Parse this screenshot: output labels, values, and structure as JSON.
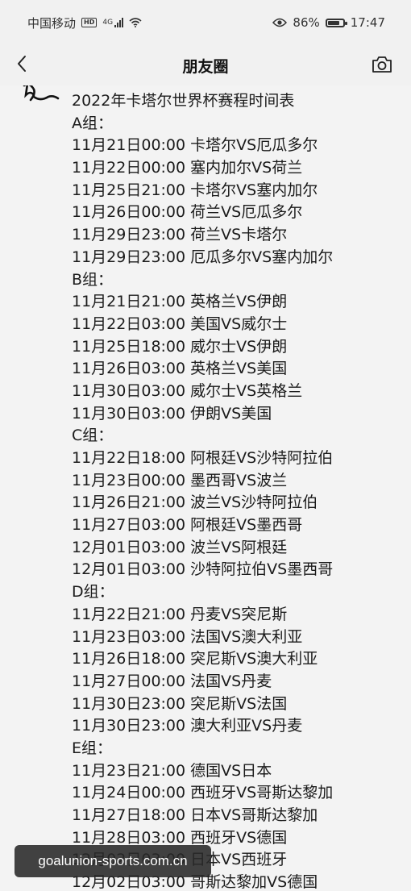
{
  "status_bar": {
    "carrier": "中国移动",
    "hd": "HD",
    "network": "4G",
    "battery": "86%",
    "time": "17:47"
  },
  "nav": {
    "title": "朋友圈"
  },
  "post": {
    "lines": [
      "2022年卡塔尔世界杯赛程时间表",
      "A组：",
      "11月21日00:00 卡塔尔VS厄瓜多尔",
      "11月22日00:00 塞内加尔VS荷兰",
      "11月25日21:00 卡塔尔VS塞内加尔",
      "11月26日00:00 荷兰VS厄瓜多尔",
      "11月29日23:00 荷兰VS卡塔尔",
      "11月29日23:00 厄瓜多尔VS塞内加尔",
      "B组：",
      "11月21日21:00 英格兰VS伊朗",
      "11月22日03:00 美国VS威尔士",
      "11月25日18:00 威尔士VS伊朗",
      "11月26日03:00 英格兰VS美国",
      "11月30日03:00 威尔士VS英格兰",
      "11月30日03:00 伊朗VS美国",
      "C组：",
      "11月22日18:00 阿根廷VS沙特阿拉伯",
      "11月23日00:00 墨西哥VS波兰",
      "11月26日21:00 波兰VS沙特阿拉伯",
      "11月27日03:00 阿根廷VS墨西哥",
      "12月01日03:00 波兰VS阿根廷",
      "12月01日03:00 沙特阿拉伯VS墨西哥",
      "D组：",
      "11月22日21:00 丹麦VS突尼斯",
      "11月23日03:00 法国VS澳大利亚",
      "11月26日18:00 突尼斯VS澳大利亚",
      "11月27日00:00 法国VS丹麦",
      "11月30日23:00 突尼斯VS法国",
      "11月30日23:00 澳大利亚VS丹麦",
      "E组：",
      "11月23日21:00 德国VS日本",
      "11月24日00:00 西班牙VS哥斯达黎加",
      "11月27日18:00 日本VS哥斯达黎加",
      "11月28日03:00 西班牙VS德国",
      "12月02日03:00 日本VS西班牙",
      "12月02日03:00 哥斯达黎加VS德国"
    ]
  },
  "watermark": {
    "text": "goalunion-sports.com.cn"
  },
  "icons": {
    "back": "chevron-left-icon",
    "camera": "camera-icon",
    "wifi": "wifi-icon",
    "eye": "eye-icon",
    "battery": "battery-icon",
    "signal": "signal-icon"
  }
}
